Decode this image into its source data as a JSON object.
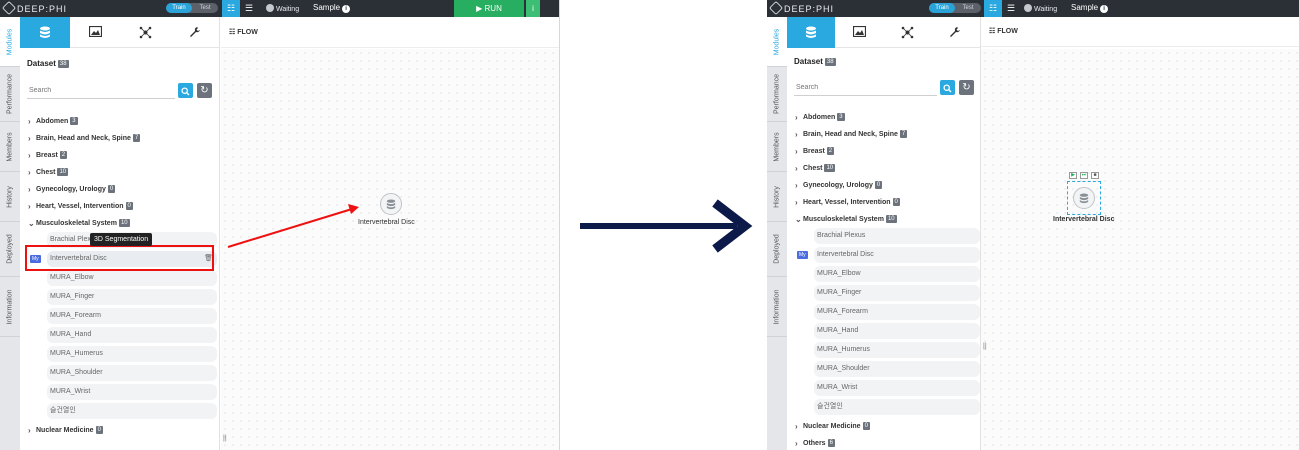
{
  "app": {
    "logo_text": "DEEP:PHI",
    "toggle_train": "Train",
    "toggle_test": "Test",
    "status_text": "Waiting",
    "project_name": "Sample",
    "run_label": "RUN",
    "info_glyph": "i"
  },
  "side_tabs": [
    "Modules",
    "Performance",
    "Members",
    "History",
    "Deployed",
    "Information"
  ],
  "category_icons": [
    "database-icon",
    "image-icon",
    "network-icon",
    "wrench-icon"
  ],
  "dataset": {
    "label": "Dataset",
    "count": "38",
    "search_placeholder": "Search"
  },
  "tree": {
    "categories": [
      {
        "name": "Abdomen",
        "count": "3"
      },
      {
        "name": "Brain, Head and Neck, Spine",
        "count": "7"
      },
      {
        "name": "Breast",
        "count": "2"
      },
      {
        "name": "Chest",
        "count": "10"
      },
      {
        "name": "Gynecology, Urology",
        "count": "0"
      },
      {
        "name": "Heart, Vessel, Intervention",
        "count": "0"
      },
      {
        "name": "Musculoskeletal System",
        "count": "10"
      }
    ],
    "msk_items": [
      "Brachial Plexus",
      "Intervertebral Disc",
      "MURA_Elbow",
      "MURA_Finger",
      "MURA_Forearm",
      "MURA_Hand",
      "MURA_Humerus",
      "MURA_Shoulder",
      "MURA_Wrist",
      "슬건열인"
    ],
    "trailing_categories": [
      {
        "name": "Nuclear Medicine",
        "count": "0"
      },
      {
        "name": "Others",
        "count": "6"
      }
    ],
    "my_badge": "My"
  },
  "tooltip": "3D Segmentation",
  "flow": {
    "header": "FLOW",
    "node_label": "Intervertebral Disc"
  },
  "colors": {
    "accent": "#29a9e0",
    "run": "#27ae60",
    "highlight": "#ee1111",
    "arrow": "#0c1a4a"
  }
}
